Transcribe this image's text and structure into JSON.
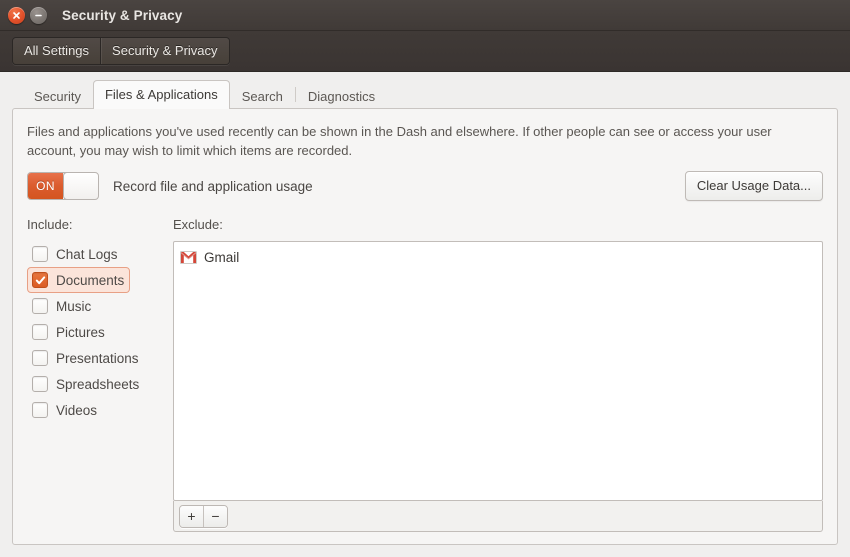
{
  "window": {
    "title": "Security & Privacy",
    "close_icon": "close-icon",
    "minimize_icon": "minimize-icon"
  },
  "toolbar": {
    "all_settings_label": "All Settings",
    "current_panel_label": "Security & Privacy"
  },
  "tabs": [
    {
      "label": "Security",
      "active": false
    },
    {
      "label": "Files & Applications",
      "active": true
    },
    {
      "label": "Search",
      "active": false
    },
    {
      "label": "Diagnostics",
      "active": false
    }
  ],
  "panel": {
    "description": "Files and applications you've used recently can be shown in the Dash and elsewhere. If other people can see or access your user account, you may wish to limit which items are recorded.",
    "toggle": {
      "state_label": "ON",
      "label": "Record file and application usage",
      "on": true
    },
    "clear_button_label": "Clear Usage Data...",
    "include": {
      "heading": "Include:",
      "items": [
        {
          "label": "Chat Logs",
          "checked": false,
          "selected": false
        },
        {
          "label": "Documents",
          "checked": true,
          "selected": true
        },
        {
          "label": "Music",
          "checked": false,
          "selected": false
        },
        {
          "label": "Pictures",
          "checked": false,
          "selected": false
        },
        {
          "label": "Presentations",
          "checked": false,
          "selected": false
        },
        {
          "label": "Spreadsheets",
          "checked": false,
          "selected": false
        },
        {
          "label": "Videos",
          "checked": false,
          "selected": false
        }
      ]
    },
    "exclude": {
      "heading": "Exclude:",
      "items": [
        {
          "label": "Gmail",
          "icon": "gmail-icon"
        }
      ],
      "add_label": "+",
      "remove_label": "−"
    }
  },
  "colors": {
    "accent_orange": "#db5c2e",
    "titlebar": "#403a37",
    "window_bg": "#f0efee",
    "panel_bg": "#f6f5f4",
    "selection_bg": "#fbe4da",
    "gmail_red": "#d44638"
  }
}
